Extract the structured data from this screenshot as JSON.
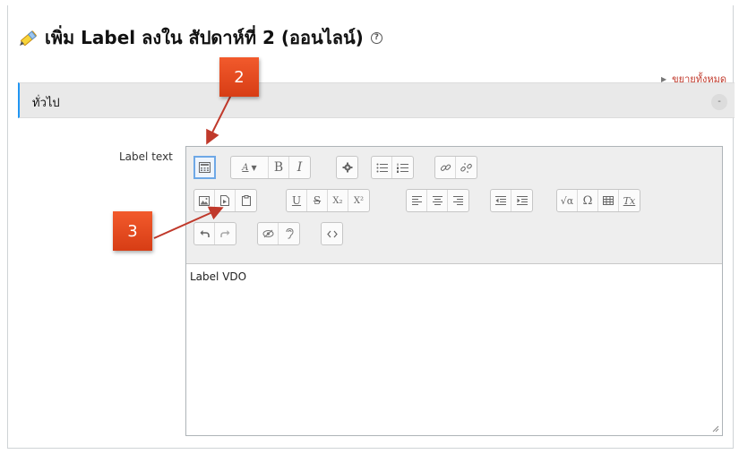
{
  "header": {
    "title": "เพิ่ม Label ลงใน สัปดาห์ที่ 2 (ออนไลน์)",
    "help_symbol": "?"
  },
  "expand_all_link": "ขยายทั้งหมด",
  "section": {
    "label": "ทั่วไป",
    "collapse_symbol": "-"
  },
  "form": {
    "label_text_caption": "Label text"
  },
  "editor": {
    "content": "Label VDO",
    "toolbar_row1": [
      "toolbar-toggle",
      "font-style",
      "bold",
      "italic",
      "settings",
      "unordered-list",
      "ordered-list",
      "link",
      "unlink"
    ],
    "toolbar_row2": [
      "image",
      "media",
      "file",
      "underline",
      "strikethrough",
      "subscript",
      "superscript",
      "align-left",
      "align-center",
      "align-right",
      "outdent",
      "indent",
      "equation",
      "special-character",
      "table",
      "clear-formatting"
    ],
    "toolbar_row3": [
      "undo",
      "redo",
      "accessibility-checker",
      "screen-reader-helper",
      "html-source"
    ],
    "glyphs": {
      "bold": "B",
      "italic": "I",
      "underline": "U",
      "strike": "S",
      "sub": "X₂",
      "sup": "X²",
      "omega": "Ω",
      "sqrt": "√α",
      "clear": "Tx",
      "font": "A"
    }
  },
  "callouts": {
    "step2": "2",
    "step3": "3"
  },
  "colors": {
    "callout": "#e8491d",
    "accent": "#2196f3",
    "link": "#c0392b"
  }
}
